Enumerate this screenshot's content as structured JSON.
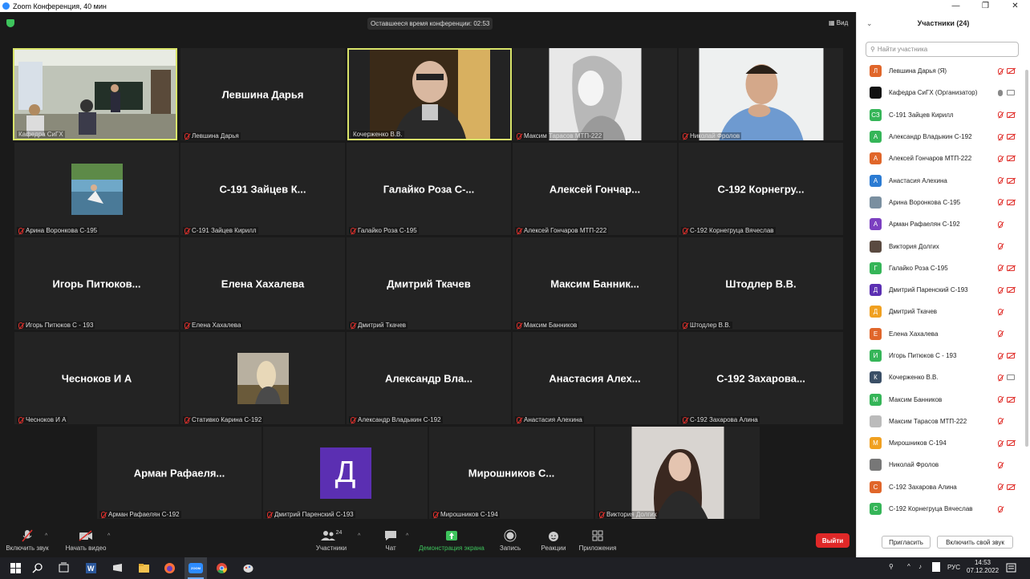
{
  "window": {
    "title": "Zoom Конференция, 40 мин"
  },
  "meeting": {
    "timer": "Оставшееся время конференции: 02:53",
    "view_label": "Вид"
  },
  "tiles": [
    {
      "label": "Кафедра СиГХ",
      "type": "video"
    },
    {
      "name": "Левшина Дарья",
      "label": "Левшина Дарья",
      "type": "name"
    },
    {
      "label": "Кочерженко В.В.",
      "type": "video"
    },
    {
      "label": "Максим Тарасов МТП-222",
      "type": "photo"
    },
    {
      "label": "Николай Фролов",
      "type": "video"
    },
    {
      "label": "Арина Воронкова С-195",
      "type": "photo"
    },
    {
      "name": "С-191 Зайцев К...",
      "label": "С-191 Зайцев Кирилл",
      "type": "name"
    },
    {
      "name": "Галайко Роза С-...",
      "label": "Галайко Роза С-195",
      "type": "name"
    },
    {
      "name": "Алексей Гончар...",
      "label": "Алексей Гончаров МТП-222",
      "type": "name"
    },
    {
      "name": "С-192 Корнегру...",
      "label": "С-192 Корнегруца Вячеслав",
      "type": "name"
    },
    {
      "name": "Игорь Питюков...",
      "label": "Игорь Питюков С - 193",
      "type": "name"
    },
    {
      "name": "Елена Хахалева",
      "label": "Елена Хахалева",
      "type": "name"
    },
    {
      "name": "Дмитрий Ткачев",
      "label": "Дмитрий Ткачев",
      "type": "name"
    },
    {
      "name": "Максим Банник...",
      "label": "Максим Банников",
      "type": "name"
    },
    {
      "name": "Штодлер В.В.",
      "label": "Штодлер В.В.",
      "type": "name"
    },
    {
      "name": "Чесноков И А",
      "label": "Чесноков И А",
      "type": "name"
    },
    {
      "label": "Стативко Карина С-192",
      "type": "photo"
    },
    {
      "name": "Александр Вла...",
      "label": "Александр Владыкин С-192",
      "type": "name"
    },
    {
      "name": "Анастасия Алех...",
      "label": "Анастасия Алехина",
      "type": "name"
    },
    {
      "name": "С-192 Захарова...",
      "label": "С-192 Захарова Алина",
      "type": "name"
    },
    {
      "name": "Арман Рафаеля...",
      "label": "Арман Рафаелян С-192",
      "type": "name"
    },
    {
      "letter": "Д",
      "label": "Дмитрий Паренский С-193",
      "type": "letter"
    },
    {
      "name": "Мирошников С...",
      "label": "Мирошников С-194",
      "type": "name"
    },
    {
      "label": "Виктория Долгих",
      "type": "photo"
    }
  ],
  "toolbar": {
    "mute": "Включить звук",
    "video": "Начать видео",
    "participants": "Участники",
    "participants_count": "24",
    "chat": "Чат",
    "share": "Демонстрация экрана",
    "record": "Запись",
    "reactions": "Реакции",
    "apps": "Приложения",
    "leave": "Выйти"
  },
  "panel": {
    "title": "Участники (24)",
    "search_placeholder": "Найти участника",
    "invite": "Пригласить",
    "unmute_me": "Включить свой звук",
    "participants": [
      {
        "name": "Левшина Дарья (Я)",
        "av": "Л",
        "color": "#e0662a",
        "mic": "off",
        "cam": "off"
      },
      {
        "name": "Кафедра СиГХ (Организатор)",
        "av": "",
        "color": "#111111",
        "mic": "on",
        "cam": "on"
      },
      {
        "name": "С-191 Зайцев Кирилл",
        "av": "СЗ",
        "color": "#35b558",
        "mic": "off",
        "cam": "off"
      },
      {
        "name": "Александр Владыкин С-192",
        "av": "А",
        "color": "#35b558",
        "mic": "off",
        "cam": "off"
      },
      {
        "name": "Алексей Гончаров МТП-222",
        "av": "А",
        "color": "#e0662a",
        "mic": "off",
        "cam": "off"
      },
      {
        "name": "Анастасия Алехина",
        "av": "А",
        "color": "#2b7bd3",
        "mic": "off",
        "cam": "off"
      },
      {
        "name": "Арина Воронкова С-195",
        "av": "",
        "color": "#7a8fa0",
        "mic": "off",
        "cam": "off"
      },
      {
        "name": "Арман Рафаелян С-192",
        "av": "А",
        "color": "#7b3fc0",
        "mic": "off",
        "cam": "none"
      },
      {
        "name": "Виктория Долгих",
        "av": "",
        "color": "#5a4a40",
        "mic": "off",
        "cam": "none"
      },
      {
        "name": "Галайко Роза С-195",
        "av": "Г",
        "color": "#35b558",
        "mic": "off",
        "cam": "off"
      },
      {
        "name": "Дмитрий Паренский С-193",
        "av": "Д",
        "color": "#5b2fb2",
        "mic": "off",
        "cam": "off"
      },
      {
        "name": "Дмитрий Ткачев",
        "av": "Д",
        "color": "#f0a020",
        "mic": "off",
        "cam": "none"
      },
      {
        "name": "Елена Хахалева",
        "av": "Е",
        "color": "#e0662a",
        "mic": "off",
        "cam": "none"
      },
      {
        "name": "Игорь Питюков С - 193",
        "av": "И",
        "color": "#35b558",
        "mic": "off",
        "cam": "off"
      },
      {
        "name": "Кочерженко В.В.",
        "av": "К",
        "color": "#3a4f66",
        "mic": "off",
        "cam": "on"
      },
      {
        "name": "Максим Банников",
        "av": "М",
        "color": "#35b558",
        "mic": "off",
        "cam": "off"
      },
      {
        "name": "Максим Тарасов МТП-222",
        "av": "",
        "color": "#bbbbbb",
        "mic": "off",
        "cam": "none"
      },
      {
        "name": "Мирошников С-194",
        "av": "М",
        "color": "#f0a020",
        "mic": "off",
        "cam": "off"
      },
      {
        "name": "Николай Фролов",
        "av": "",
        "color": "#777777",
        "mic": "off",
        "cam": "none"
      },
      {
        "name": "С-192 Захарова Алина",
        "av": "С",
        "color": "#e0662a",
        "mic": "off",
        "cam": "off"
      },
      {
        "name": "С-192 Корнегруца Вячеслав",
        "av": "С",
        "color": "#35b558",
        "mic": "off",
        "cam": "none"
      }
    ]
  },
  "taskbar": {
    "lang": "РУС",
    "time": "14:53",
    "date": "07.12.2022",
    "zoom_label": "ZOOM"
  }
}
